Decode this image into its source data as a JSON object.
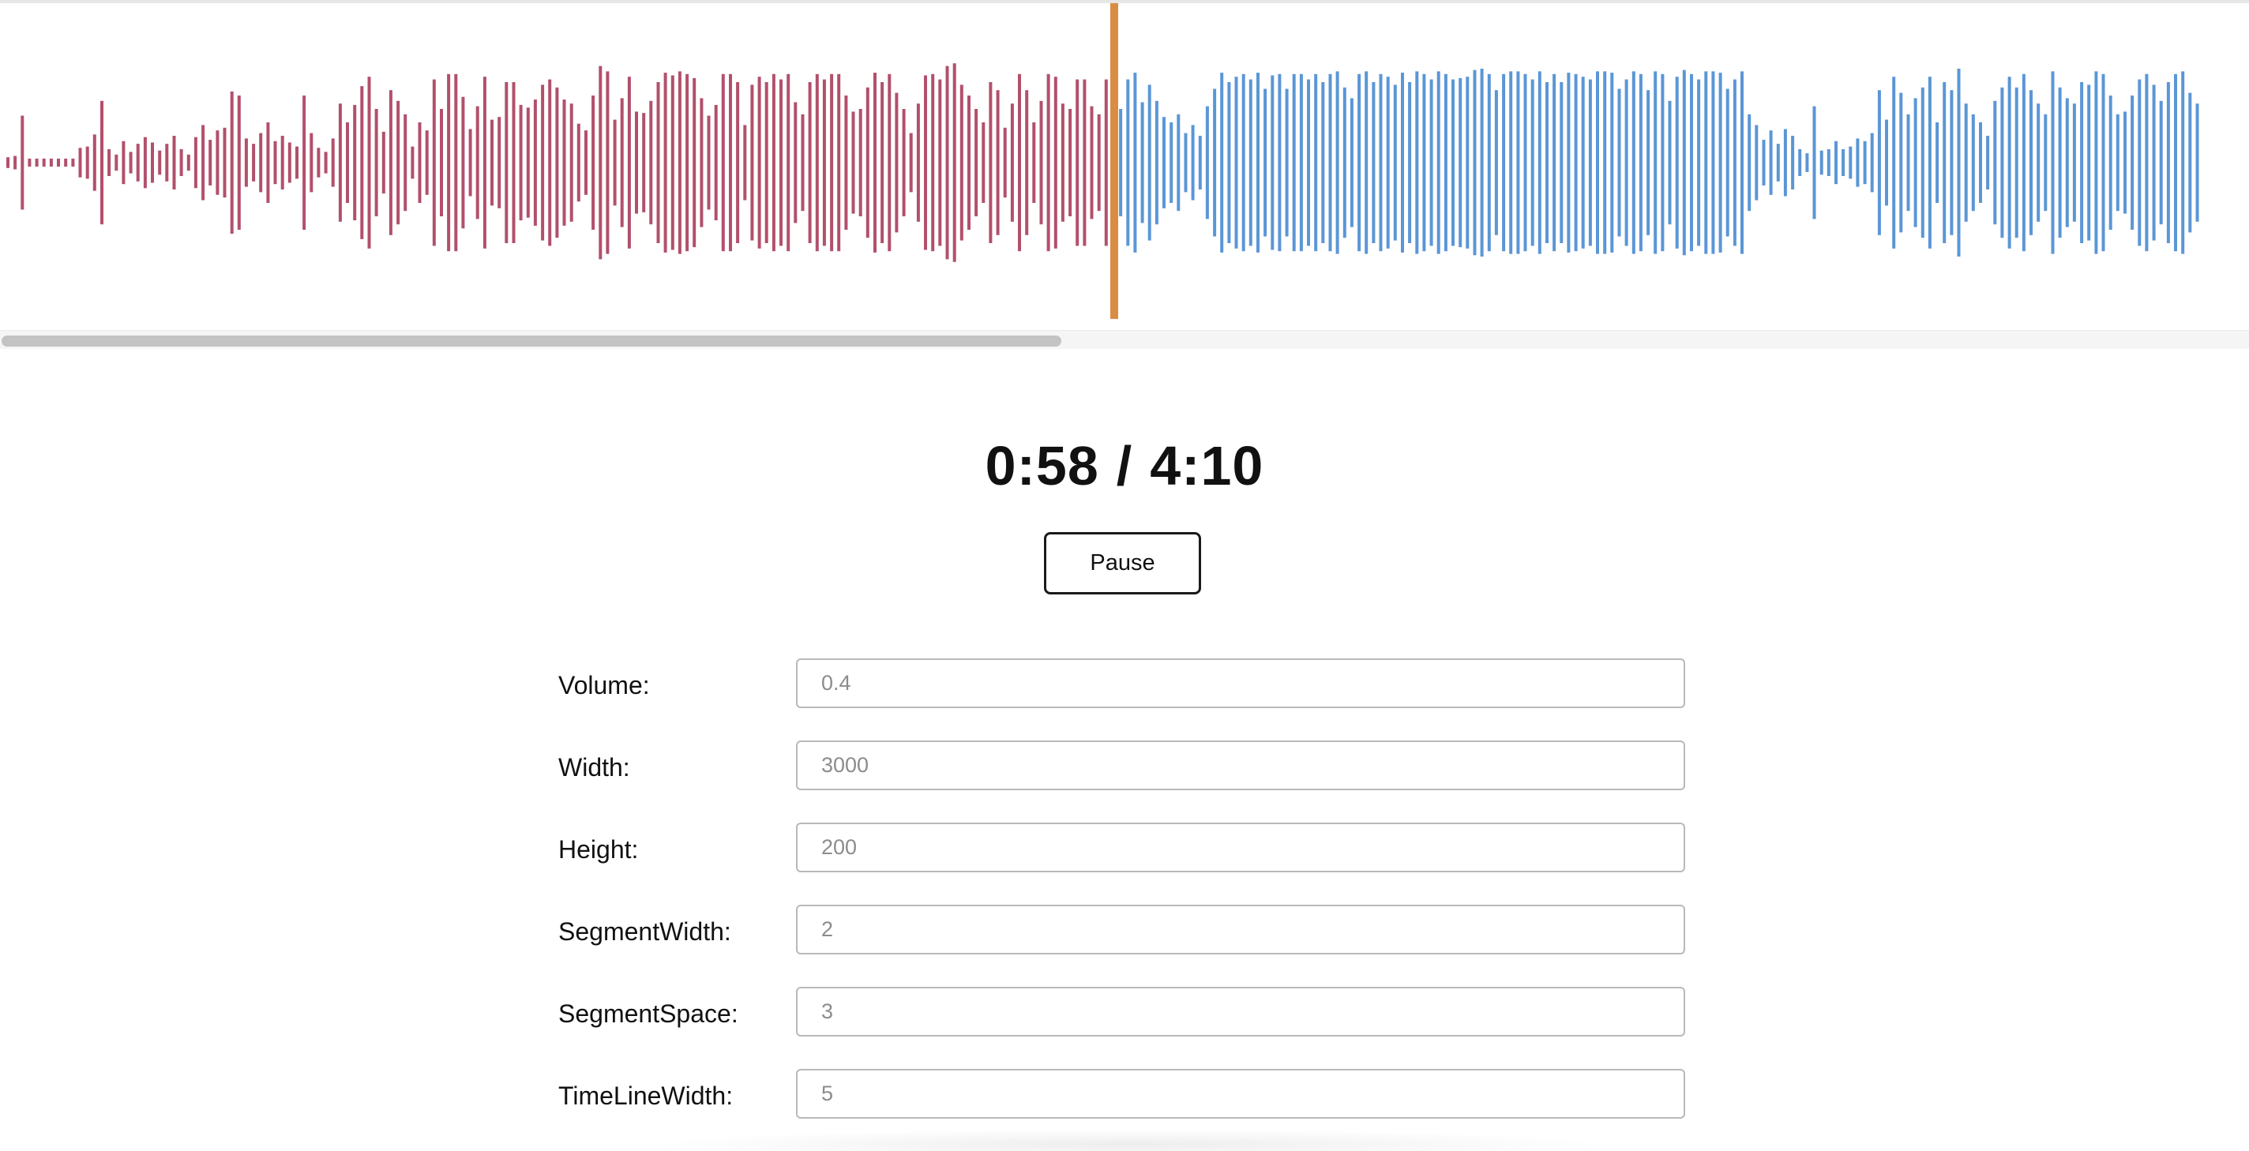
{
  "player": {
    "current_time": "0:58",
    "separator": "/",
    "total_time": "4:10",
    "pause_label": "Pause",
    "progress_fraction": 0.232
  },
  "waveform": {
    "played_color": "#b2506b",
    "unplayed_color": "#5b96d6",
    "timeline_color": "#d98d44",
    "amplitudes": [
      0.04,
      0.05,
      0.35,
      0.03,
      0.03,
      0.03,
      0.03,
      0.03,
      0.03,
      0.03,
      0.11,
      0.12,
      0.21,
      0.46,
      0.1,
      0.06,
      0.16,
      0.08,
      0.14,
      0.19,
      0.15,
      0.09,
      0.14,
      0.2,
      0.1,
      0.06,
      0.19,
      0.28,
      0.17,
      0.24,
      0.26,
      0.53,
      0.5,
      0.18,
      0.14,
      0.22,
      0.3,
      0.16,
      0.2,
      0.15,
      0.12,
      0.5,
      0.22,
      0.11,
      0.08,
      0.18,
      0.44,
      0.3,
      0.43,
      0.57,
      0.64,
      0.4,
      0.23,
      0.54,
      0.46,
      0.36,
      0.12,
      0.3,
      0.24,
      0.62,
      0.4,
      0.66,
      0.66,
      0.49,
      0.25,
      0.42,
      0.64,
      0.32,
      0.34,
      0.6,
      0.6,
      0.43,
      0.41,
      0.47,
      0.58,
      0.62,
      0.56,
      0.47,
      0.44,
      0.29,
      0.24,
      0.5,
      0.72,
      0.68,
      0.32,
      0.48,
      0.64,
      0.38,
      0.37,
      0.46,
      0.6,
      0.67,
      0.65,
      0.68,
      0.66,
      0.63,
      0.48,
      0.35,
      0.43,
      0.66,
      0.66,
      0.6,
      0.28,
      0.58,
      0.64,
      0.6,
      0.66,
      0.62,
      0.66,
      0.45,
      0.36,
      0.6,
      0.66,
      0.62,
      0.66,
      0.66,
      0.5,
      0.38,
      0.4,
      0.56,
      0.67,
      0.6,
      0.66,
      0.52,
      0.4,
      0.22,
      0.44,
      0.65,
      0.66,
      0.62,
      0.72,
      0.74,
      0.58,
      0.5,
      0.4,
      0.3,
      0.6,
      0.54,
      0.26,
      0.44,
      0.66,
      0.54,
      0.3,
      0.46,
      0.66,
      0.64,
      0.44,
      0.4,
      0.62,
      0.62,
      0.42,
      0.36,
      0.62,
      0.68
    ],
    "after_amplitudes": [
      0.4,
      0.62,
      0.67,
      0.45,
      0.58,
      0.46,
      0.34,
      0.3,
      0.36,
      0.22,
      0.28,
      0.2,
      0.42,
      0.55,
      0.67,
      0.6,
      0.64,
      0.66,
      0.62,
      0.67,
      0.55,
      0.65,
      0.66,
      0.55,
      0.66,
      0.66,
      0.62,
      0.66,
      0.6,
      0.66,
      0.68,
      0.56,
      0.48,
      0.66,
      0.68,
      0.6,
      0.66,
      0.64,
      0.58,
      0.67,
      0.6,
      0.68,
      0.66,
      0.62,
      0.68,
      0.66,
      0.62,
      0.63,
      0.64,
      0.69,
      0.7,
      0.66,
      0.54,
      0.66,
      0.68,
      0.68,
      0.66,
      0.62,
      0.68,
      0.6,
      0.66,
      0.6,
      0.67,
      0.66,
      0.64,
      0.62,
      0.68,
      0.68,
      0.67,
      0.55,
      0.62,
      0.68,
      0.66,
      0.54,
      0.68,
      0.66,
      0.46,
      0.64,
      0.69,
      0.66,
      0.62,
      0.68,
      0.68,
      0.67,
      0.55,
      0.62,
      0.68,
      0.36,
      0.28,
      0.17,
      0.24,
      0.14,
      0.25,
      0.2,
      0.1,
      0.07,
      0.42,
      0.09,
      0.1,
      0.16,
      0.1,
      0.12,
      0.18,
      0.16,
      0.22,
      0.54,
      0.32,
      0.64,
      0.52,
      0.36,
      0.48,
      0.56,
      0.64,
      0.3,
      0.6,
      0.54,
      0.7,
      0.44,
      0.36,
      0.3,
      0.2,
      0.46,
      0.56,
      0.64,
      0.56,
      0.66,
      0.54,
      0.44,
      0.36,
      0.68,
      0.56,
      0.48,
      0.44,
      0.6,
      0.58,
      0.68,
      0.66,
      0.5,
      0.36,
      0.38,
      0.5,
      0.62,
      0.66,
      0.58,
      0.46,
      0.6,
      0.66,
      0.68,
      0.52,
      0.44
    ]
  },
  "settings": [
    {
      "label": "Volume:",
      "placeholder": "0.4"
    },
    {
      "label": "Width:",
      "placeholder": "3000"
    },
    {
      "label": "Height:",
      "placeholder": "200"
    },
    {
      "label": "SegmentWidth:",
      "placeholder": "2"
    },
    {
      "label": "SegmentSpace:",
      "placeholder": "3"
    },
    {
      "label": "TimeLineWidth:",
      "placeholder": "5"
    }
  ]
}
